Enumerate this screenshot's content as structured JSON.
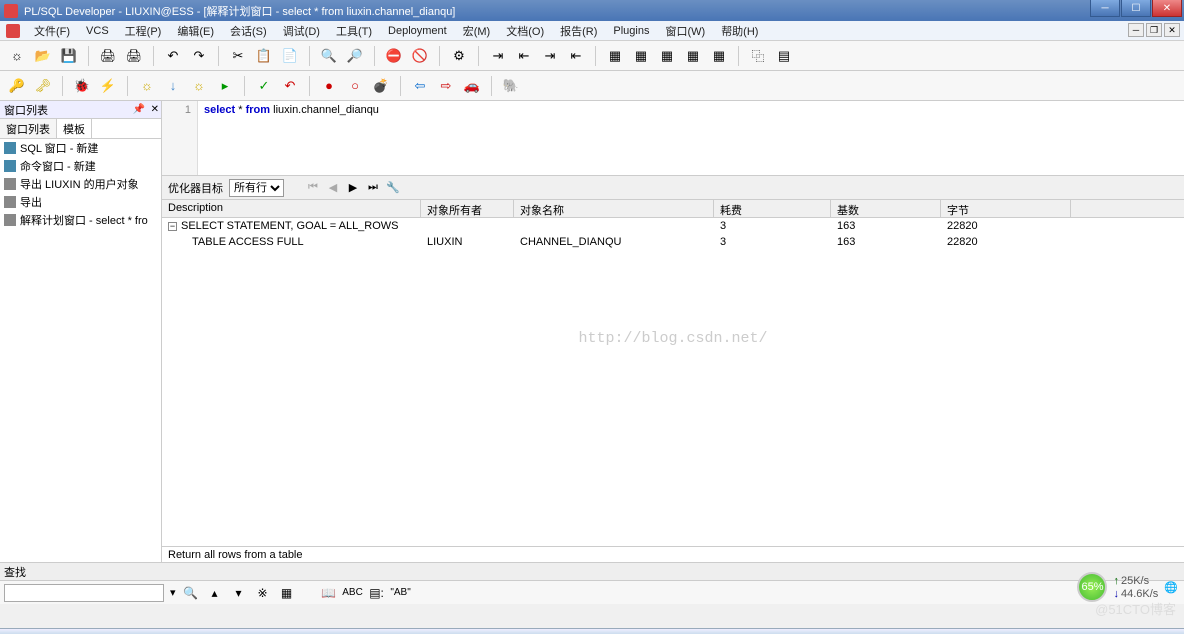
{
  "title": "PL/SQL Developer - LIUXIN@ESS - [解释计划窗口 - select * from liuxin.channel_dianqu]",
  "menus": [
    "文件(F)",
    "VCS",
    "工程(P)",
    "编辑(E)",
    "会话(S)",
    "调试(D)",
    "工具(T)",
    "Deployment",
    "宏(M)",
    "文档(O)",
    "报告(R)",
    "Plugins",
    "窗口(W)",
    "帮助(H)"
  ],
  "sidebar": {
    "header": "窗口列表",
    "tabs": [
      "窗口列表",
      "模板"
    ],
    "items": [
      {
        "icon": "blue",
        "label": "SQL 窗口 - 新建"
      },
      {
        "icon": "blue",
        "label": "命令窗口 - 新建"
      },
      {
        "icon": "gray",
        "label": "导出 LIUXIN 的用户对象"
      },
      {
        "icon": "gray",
        "label": "导出"
      },
      {
        "icon": "gray",
        "label": "解释计划窗口 - select * fro"
      }
    ]
  },
  "sql": {
    "line_no": "1",
    "kw1": "select",
    "star": " * ",
    "kw2": "from",
    "rest": " liuxin.channel_dianqu"
  },
  "plan_toolbar": {
    "label": "优化器目标",
    "select": "所有行"
  },
  "plan": {
    "headers": {
      "desc": "Description",
      "owner": "对象所有者",
      "name": "对象名称",
      "cost": "耗费",
      "card": "基数",
      "bytes": "字节"
    },
    "rows": [
      {
        "desc": "SELECT STATEMENT, GOAL = ALL_ROWS",
        "owner": "",
        "name": "",
        "cost": "3",
        "card": "163",
        "bytes": "22820"
      },
      {
        "desc": "TABLE ACCESS FULL",
        "owner": "LIUXIN",
        "name": "CHANNEL_DIANQU",
        "cost": "3",
        "card": "163",
        "bytes": "22820"
      }
    ]
  },
  "status": "Return all rows from a table",
  "search_label": "查找",
  "search_sample": "\"AB\"",
  "watermark": "http://blog.csdn.net/",
  "watermark2": "@51CTO博客",
  "net": {
    "up": "25K/s",
    "dn": "44.6K/s"
  },
  "percent": "65%",
  "abc": "ABC"
}
